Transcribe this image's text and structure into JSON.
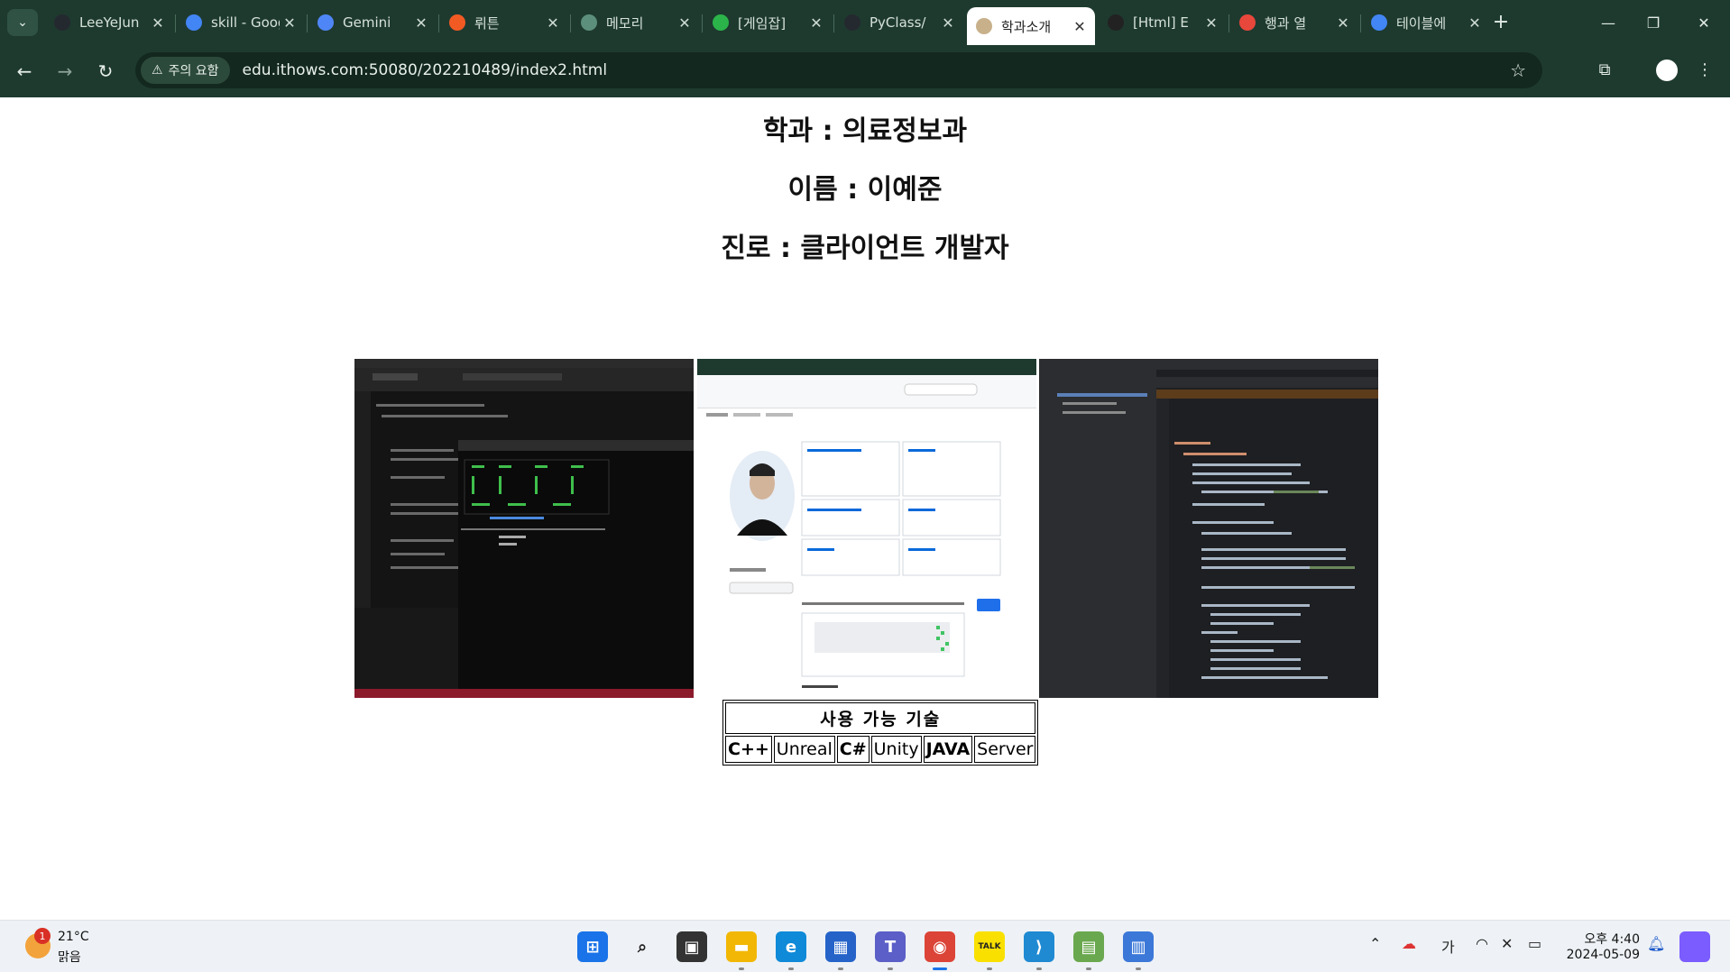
{
  "browser": {
    "tabs": [
      {
        "title": "LeeYeJun",
        "icon": "github-icon",
        "color": "#24292f"
      },
      {
        "title": "skill - Google",
        "icon": "google-icon",
        "color": "#4285f4"
      },
      {
        "title": "Gemini",
        "icon": "gemini-icon",
        "color": "#4f86f7"
      },
      {
        "title": "뤼튼",
        "icon": "wrtn-icon",
        "color": "#f25a24"
      },
      {
        "title": "메모리",
        "icon": "chatgpt-icon",
        "color": "#5c8f7c"
      },
      {
        "title": "[게임잡]",
        "icon": "gamejob-icon",
        "color": "#2bb44a"
      },
      {
        "title": "PyClass/",
        "icon": "github-icon",
        "color": "#24292f"
      },
      {
        "title": "학과소개",
        "icon": "page-icon",
        "color": "#c8b08a"
      },
      {
        "title": "[Html] E",
        "icon": "bar-chart-icon",
        "color": "#222222"
      },
      {
        "title": "행과 열",
        "icon": "circle-t-icon",
        "color": "#e8473c"
      },
      {
        "title": "테이블에",
        "icon": "google-icon",
        "color": "#4285f4"
      }
    ],
    "active_tab_index": 7,
    "address": {
      "warning": "주의 요함",
      "url": "edu.ithows.com:50080/202210489/index2.html"
    }
  },
  "page": {
    "dept": "학과 : 의료정보과",
    "name": "이름 : 이예준",
    "career": "진로 : 클라이언트 개발자",
    "skills_table": {
      "header": "사용 가능 기술",
      "cells": [
        {
          "label": "C++",
          "bold": true
        },
        {
          "label": "Unreal",
          "bold": false
        },
        {
          "label": "C#",
          "bold": true
        },
        {
          "label": "Unity",
          "bold": false
        },
        {
          "label": "JAVA",
          "bold": true
        },
        {
          "label": "Server",
          "bold": false
        }
      ]
    },
    "screenshots": [
      {
        "label": "unreal-editor-screenshot"
      },
      {
        "label": "github-profile-screenshot"
      },
      {
        "label": "java-ide-screenshot"
      }
    ]
  },
  "taskbar": {
    "weather_temp": "21°C",
    "weather_cond": "맑음",
    "weather_badge": "1",
    "ime": "가",
    "time": "오후 4:40",
    "date": "2024-05-09",
    "apps": [
      {
        "name": "start-icon",
        "color": "#1a73e8",
        "glyph": "⊞"
      },
      {
        "name": "search-icon",
        "color": "#eef2f6",
        "glyph": "⌕"
      },
      {
        "name": "task-view-icon",
        "color": "#333333",
        "glyph": "▣"
      },
      {
        "name": "file-explorer-icon",
        "color": "#f2b705",
        "glyph": "▬"
      },
      {
        "name": "edge-icon",
        "color": "#0f8ad8",
        "glyph": "e"
      },
      {
        "name": "store-icon",
        "color": "#2563c9",
        "glyph": "▦"
      },
      {
        "name": "teams-icon",
        "color": "#5b5fc7",
        "glyph": "T"
      },
      {
        "name": "chrome-icon",
        "color": "#db4437",
        "glyph": "◉"
      },
      {
        "name": "kakaotalk-icon",
        "color": "#f9e000",
        "glyph": "TALK"
      },
      {
        "name": "vscode-icon",
        "color": "#1f8ad2",
        "glyph": "⟩"
      },
      {
        "name": "network-tool-icon",
        "color": "#6aa84f",
        "glyph": "▤"
      },
      {
        "name": "remote-desktop-icon",
        "color": "#3c78d8",
        "glyph": "▥"
      }
    ]
  }
}
